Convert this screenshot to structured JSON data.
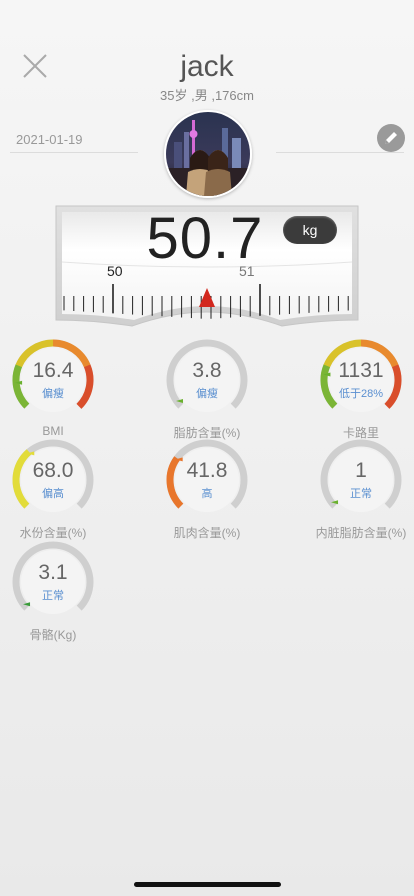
{
  "profile": {
    "name": "jack",
    "details": "35岁 ,男 ,176cm",
    "date": "2021-01-19"
  },
  "scale": {
    "weight": "50.7",
    "unit": "kg",
    "tick_left": "50",
    "tick_right": "51"
  },
  "metrics": [
    {
      "value": "16.4",
      "status": "偏瘦",
      "label": "BMI",
      "level": 0.15,
      "color": "#d9c22a",
      "colors": [
        "#7bb536",
        "#d9c22a",
        "#e88a2e",
        "#d94e2b"
      ]
    },
    {
      "value": "3.8",
      "status": "偏瘦",
      "label": "脂肪含量(%)",
      "level": 0.03,
      "color": "#6ab12e"
    },
    {
      "value": "1131",
      "status": "低于28%",
      "label": "卡路里",
      "level": 0.2,
      "color": "#d9c22a",
      "colors": [
        "#7bb536",
        "#d9c22a",
        "#e88a2e",
        "#d94e2b"
      ]
    },
    {
      "value": "68.0",
      "status": "偏高",
      "label": "水份含量(%)",
      "level": 0.35,
      "color": "#e2dc3a"
    },
    {
      "value": "41.8",
      "status": "高",
      "label": "肌肉含量(%)",
      "level": 0.3,
      "color": "#e8762c"
    },
    {
      "value": "1",
      "status": "正常",
      "label": "内脏脂肪含量(%)",
      "level": 0.02,
      "color": "#6ab12e"
    },
    {
      "value": "3.1",
      "status": "正常",
      "label": "骨骼(Kg)",
      "level": 0.02,
      "color": "#3a9c3a"
    }
  ]
}
